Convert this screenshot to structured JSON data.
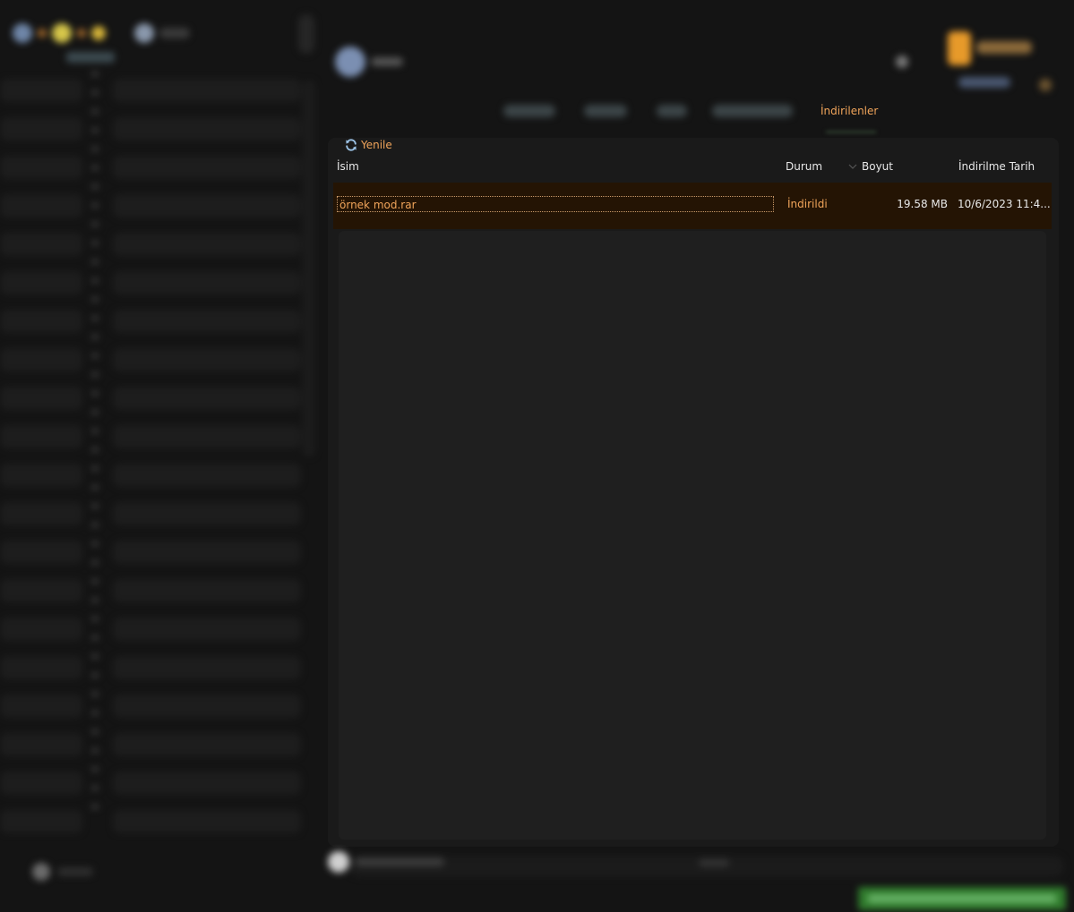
{
  "tabs": {
    "active_label": "İndirilenler"
  },
  "toolbar": {
    "refresh_label": "Yenile"
  },
  "table": {
    "columns": {
      "name": "İsim",
      "status": "Durum",
      "size": "Boyut",
      "date": "İndirilme Tarih"
    },
    "rows": [
      {
        "name": "örnek mod.rar",
        "status": "İndirildi",
        "size": "19.58 MB",
        "date": "10/6/2023 11:4..."
      }
    ]
  },
  "colors": {
    "accent": "#f0a45a",
    "selected_row": "#241404",
    "background": "#141414",
    "status_badge": "#2f7a2c"
  }
}
